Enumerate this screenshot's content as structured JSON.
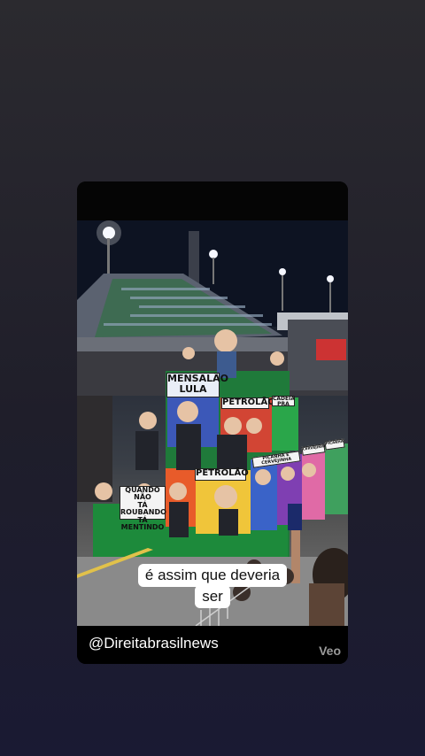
{
  "post": {
    "signs": {
      "mensalao_1": "MENSALÃO",
      "mensalao_2": "LULA",
      "petrolao_top": "PETROLÃO",
      "cadeia": "CADEIA PRA",
      "quando_1": "QUANDO NÃO",
      "quando_2": "TÁ ROUBANDO",
      "quando_3": "TÁ MENTINDO",
      "petrolao_bottom": "PETROLÃO",
      "picanha": "PICANHA E CERVEJINHA",
      "cervejinha": "CERVEJINHA",
      "picanha_2": "PICANHA"
    },
    "caption_line1": "é assim que deveria",
    "caption_line2": "ser",
    "handle": "@Direitabrasilnews",
    "watermark": "Veo"
  }
}
